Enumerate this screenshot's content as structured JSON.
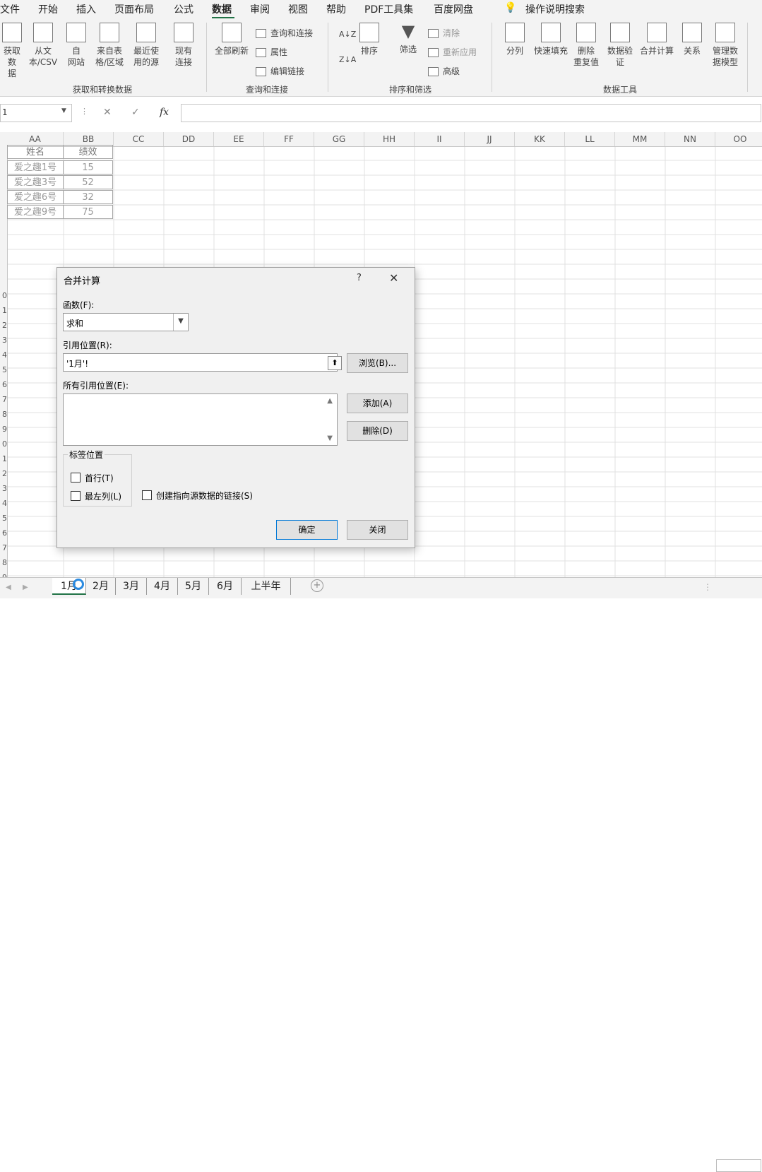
{
  "menu": {
    "items": [
      "文件",
      "开始",
      "插入",
      "页面布局",
      "公式",
      "数据",
      "审阅",
      "视图",
      "帮助",
      "PDF工具集",
      "百度网盘"
    ],
    "active": "数据",
    "tell_me": "操作说明搜索"
  },
  "ribbon": {
    "get_transform": {
      "buttons": [
        "获取数\n据",
        "从文\n本/CSV",
        "自\n网站",
        "来自表\n格/区域",
        "最近使\n用的源",
        "现有\n连接"
      ],
      "label": "获取和转换数据"
    },
    "queries": {
      "refresh": "全部刷新",
      "items": [
        "查询和连接",
        "属性",
        "编辑链接"
      ],
      "label": "查询和连接"
    },
    "sort_filter": {
      "sort": "排序",
      "filter": "筛选",
      "items": [
        "清除",
        "重新应用",
        "高级"
      ],
      "label": "排序和筛选"
    },
    "data_tools": {
      "buttons": [
        "分列",
        "快速填充",
        "删除\n重复值",
        "数据验\n证",
        "合并计算",
        "关系",
        "管理数\n据模型"
      ],
      "label": "数据工具"
    }
  },
  "formula_bar": {
    "name_box": "1",
    "fx": "fx"
  },
  "grid": {
    "columns": [
      "AA",
      "BB",
      "CC",
      "DD",
      "EE",
      "FF",
      "GG",
      "HH",
      "II",
      "JJ",
      "KK",
      "LL",
      "MM",
      "NN",
      "OO"
    ],
    "row_numbers": [
      "0",
      "1",
      "2",
      "3",
      "4",
      "5",
      "6",
      "7",
      "8",
      "9",
      "0",
      "1",
      "2",
      "3",
      "4",
      "5",
      "6",
      "7",
      "8",
      "9",
      "0"
    ],
    "table": {
      "headers": [
        "姓名",
        "绩效"
      ],
      "rows": [
        [
          "爱之趣1号",
          "15"
        ],
        [
          "爱之趣3号",
          "52"
        ],
        [
          "爱之趣6号",
          "32"
        ],
        [
          "爱之趣9号",
          "75"
        ]
      ]
    }
  },
  "dialog": {
    "title": "合并计算",
    "help": "?",
    "close": "✕",
    "function_label": "函数(F):",
    "function_value": "求和",
    "reference_label": "引用位置(R):",
    "reference_value": "'1月'!",
    "browse_button": "浏览(B)...",
    "all_refs_label": "所有引用位置(E):",
    "add_button": "添加(A)",
    "delete_button": "删除(D)",
    "labels_group": "标签位置",
    "top_row": "首行(T)",
    "left_column": "最左列(L)",
    "create_links": "创建指向源数据的链接(S)",
    "ok_button": "确定",
    "close_button": "关闭"
  },
  "sheets": {
    "tabs": [
      "1月",
      "2月",
      "3月",
      "4月",
      "5月",
      "6月",
      "上半年"
    ],
    "active": "1月"
  }
}
